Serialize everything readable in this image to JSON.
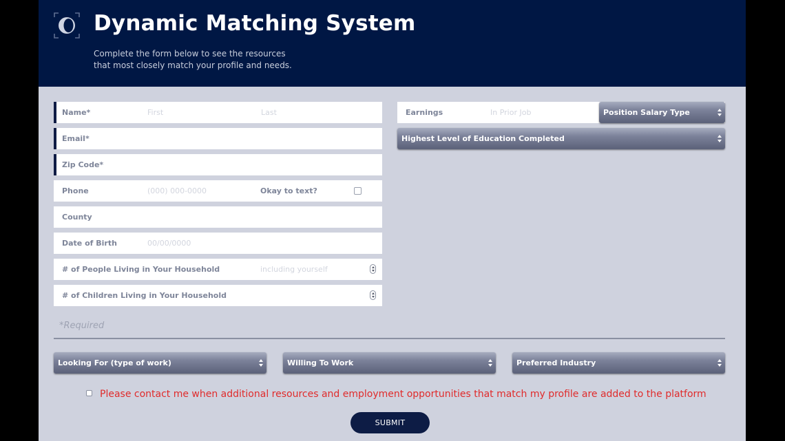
{
  "header": {
    "logo_icon": "target-o-icon",
    "title": "Dynamic Matching System",
    "subtitle_line1": "Complete the form below to see the resources",
    "subtitle_line2": "that most closely match your profile and needs."
  },
  "form": {
    "name": {
      "label": "Name*",
      "first_placeholder": "First",
      "last_placeholder": "Last"
    },
    "email": {
      "label": "Email*"
    },
    "zip": {
      "label": "Zip Code*"
    },
    "phone": {
      "label": "Phone",
      "placeholder": "(000) 000-0000",
      "text_label": "Okay to text?"
    },
    "county": {
      "label": "County"
    },
    "dob": {
      "label": "Date of Birth",
      "placeholder": "00/00/0000"
    },
    "household": {
      "label": "# of People Living in Your Household",
      "placeholder": "including yourself"
    },
    "children": {
      "label": "# of Children Living in Your Household"
    },
    "earnings": {
      "label": "Earnings",
      "placeholder": "In Prior Job"
    },
    "salary_type": {
      "label": "Position Salary Type"
    },
    "education": {
      "label": "Highest Level of Education Completed"
    },
    "required_note": "*Required",
    "looking_for": {
      "label": "Looking For (type of work)"
    },
    "willing_to_work": {
      "label": "Willing To Work"
    },
    "preferred_industry": {
      "label": "Preferred Industry"
    },
    "consent_text": "Please contact me when additional resources and employment opportunities that match my profile are added to the platform",
    "submit_label": "SUBMIT"
  },
  "colors": {
    "header_bg": "#001744",
    "page_bg": "#cfd2de",
    "accent": "#0d1c45",
    "consent_text": "#e02b2b"
  }
}
